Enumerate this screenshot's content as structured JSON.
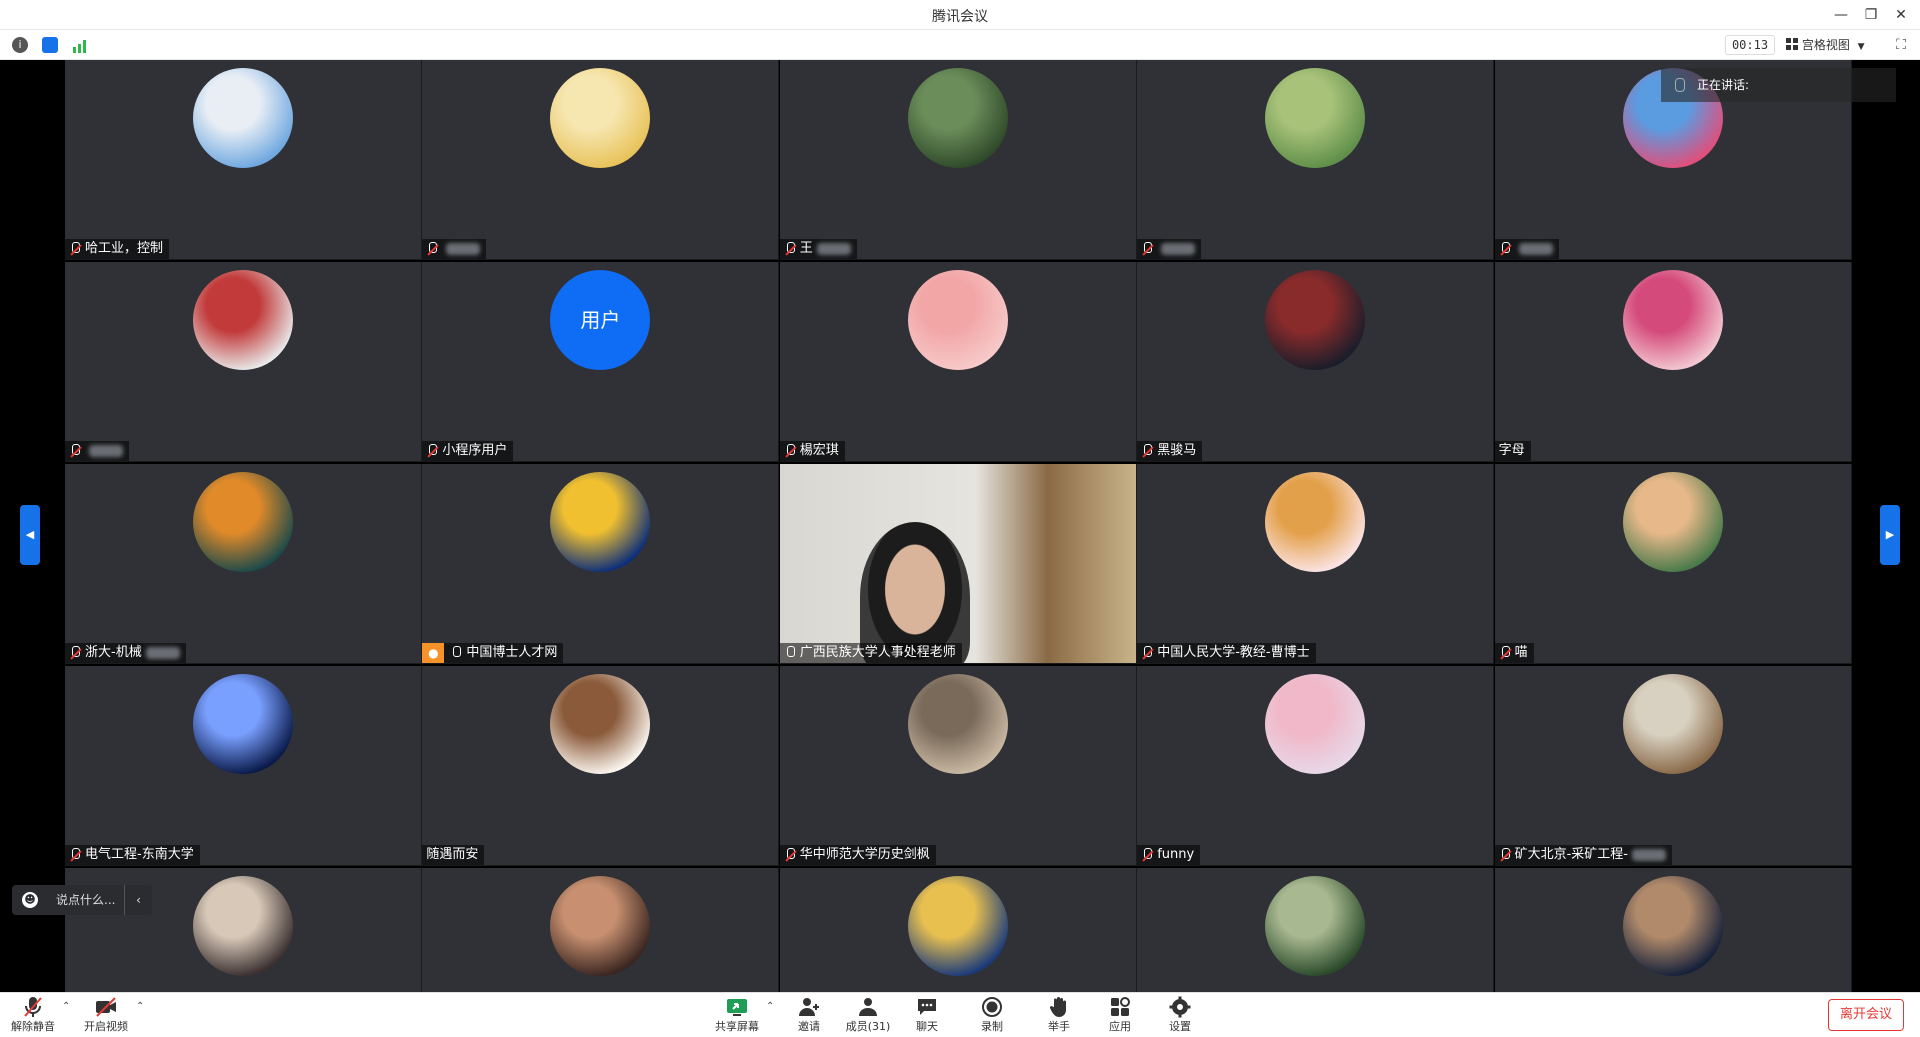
{
  "window": {
    "title": "腾讯会议"
  },
  "status": {
    "timer": "00:13",
    "view_mode": "宫格视图"
  },
  "speaking": {
    "label": "正在讲话:"
  },
  "chat": {
    "placeholder": "说点什么..."
  },
  "tiles": [
    {
      "name": "哈工业，控制",
      "muted": true,
      "redacted": false
    },
    {
      "name": "",
      "muted": true,
      "redacted": true
    },
    {
      "name": "王",
      "muted": true,
      "redacted": true
    },
    {
      "name": "",
      "muted": true,
      "redacted": true
    },
    {
      "name": "",
      "muted": true,
      "redacted": true
    },
    {
      "name": "",
      "muted": true,
      "redacted": true
    },
    {
      "name": "小程序用户",
      "muted": true,
      "redacted": false,
      "avatar_text": "用户"
    },
    {
      "name": "楊宏琪",
      "muted": true,
      "redacted": false
    },
    {
      "name": "黑骏马",
      "muted": true,
      "redacted": false
    },
    {
      "name": "字母",
      "muted": false,
      "redacted": false
    },
    {
      "name": "浙大-机械",
      "muted": true,
      "redacted": true
    },
    {
      "name": "中国博士人才网",
      "muted": false,
      "redacted": false,
      "host": true
    },
    {
      "name": "广西民族大学人事处程老师",
      "muted": false,
      "redacted": false,
      "video": true
    },
    {
      "name": "中国人民大学-教经-曹博士",
      "muted": true,
      "redacted": false
    },
    {
      "name": "喵",
      "muted": true,
      "redacted": false
    },
    {
      "name": "电气工程-东南大学",
      "muted": true,
      "redacted": false
    },
    {
      "name": "随遇而安",
      "muted": false,
      "redacted": false
    },
    {
      "name": "华中师范大学历史剑枫",
      "muted": true,
      "redacted": false
    },
    {
      "name": "funny",
      "muted": true,
      "redacted": false
    },
    {
      "name": "矿大北京-采矿工程-",
      "muted": true,
      "redacted": true
    },
    {
      "name": "",
      "muted": false,
      "redacted": false
    },
    {
      "name": "",
      "muted": false,
      "redacted": false
    },
    {
      "name": "",
      "muted": false,
      "redacted": false
    },
    {
      "name": "",
      "muted": false,
      "redacted": false
    },
    {
      "name": "",
      "muted": false,
      "redacted": false
    }
  ],
  "toolbar": {
    "unmute": "解除静音",
    "start_video": "开启视频",
    "share_screen": "共享屏幕",
    "invite": "邀请",
    "members": "成员(31)",
    "chat": "聊天",
    "record": "录制",
    "raise_hand": "举手",
    "apps": "应用",
    "settings": "设置",
    "leave": "离开会议"
  },
  "colors": {
    "accent": "#1572e8",
    "danger": "#e53935",
    "tile_bg": "#2f3136"
  }
}
